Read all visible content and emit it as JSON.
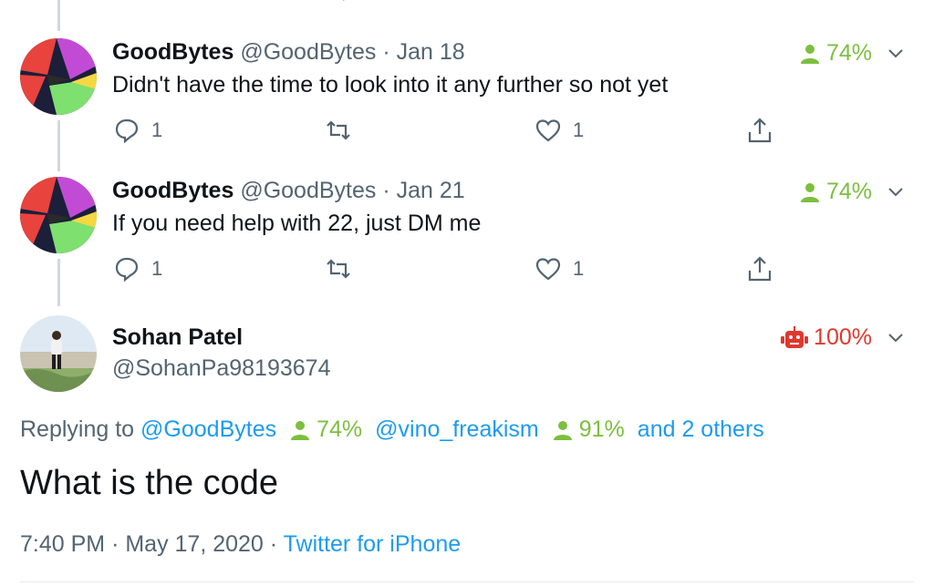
{
  "tweets": [
    {
      "name": "GoodBytes",
      "handle": "@GoodBytes",
      "date": "Jan 18",
      "text": "Didn't have the time to look into it any further so not yet",
      "score": "74%",
      "replies": "1",
      "likes": "1"
    },
    {
      "name": "GoodBytes",
      "handle": "@GoodBytes",
      "date": "Jan 21",
      "text": "If you need help with 22, just DM me",
      "score": "74%",
      "replies": "1",
      "likes": "1"
    }
  ],
  "main": {
    "name": "Sohan Patel",
    "handle": "@SohanPa98193674",
    "score": "100%",
    "replying_label": "Replying to",
    "mention1": "@GoodBytes",
    "mention1_score": "74%",
    "mention2": "@vino_freakism",
    "mention2_score": "91%",
    "others": "and 2 others",
    "text": "What is the code",
    "time": "7:40 PM",
    "date": "May 17, 2020",
    "source": "Twitter for iPhone"
  },
  "colors": {
    "human_score": "#7cbf3f",
    "bot_score": "#e0382e",
    "link": "#1d9bf0",
    "secondary_text": "#536471"
  },
  "icons": {
    "human": "person-icon",
    "bot": "robot-icon"
  }
}
